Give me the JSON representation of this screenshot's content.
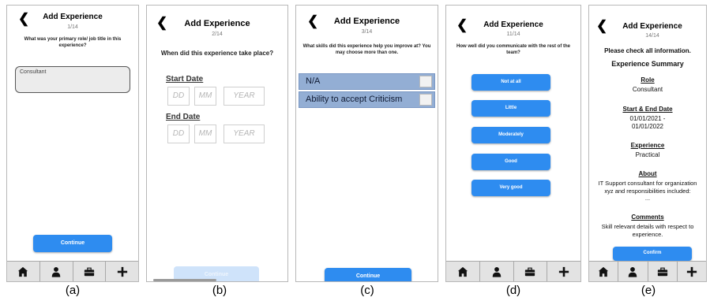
{
  "panel_a": {
    "back": "❮",
    "title": "Add Experience",
    "step": "1/14",
    "question": "What was your primary role/ job title in this experience?",
    "input_value": "Consultant",
    "continue_label": "Continue",
    "caption": "(a)"
  },
  "panel_b": {
    "back": "❮",
    "title": "Add Experience",
    "step": "2/14",
    "question": "When did this experience take place?",
    "start_label": "Start Date",
    "end_label": "End Date",
    "dd_placeholder": "DD",
    "mm_placeholder": "MM",
    "year_placeholder": "YEAR",
    "continue_label": "Continue",
    "caption": "(b)"
  },
  "panel_c": {
    "back": "❮",
    "title": "Add Experience",
    "step": "3/14",
    "question": "What skills did this experience help you improve at? You may choose more than one.",
    "skills": [
      "N/A",
      "Ability to accept Criticism"
    ],
    "continue_label": "Continue",
    "caption": "(c)"
  },
  "panel_d": {
    "back": "❮",
    "title": "Add Experience",
    "step": "11/14",
    "question": "How well did you communicate with the rest of the team?",
    "options": [
      "Not at all",
      "Little",
      "Moderately",
      "Good",
      "Very good"
    ],
    "caption": "(d)"
  },
  "panel_e": {
    "back": "❮",
    "title": "Add Experience",
    "step": "14/14",
    "instruction": "Please check all information.",
    "summary_title": "Experience Summary",
    "role_head": "Role",
    "role_value": "Consultant",
    "dates_head": "Start & End Date",
    "dates_value_1": "01/01/2021 -",
    "dates_value_2": "01/01/2022",
    "experience_head": "Experience",
    "experience_value": "Practical",
    "about_head": "About",
    "about_value_1": "IT Support consultant for organization",
    "about_value_2": "xyz and responsibilities included:",
    "about_value_3": "...",
    "comments_head": "Comments",
    "comments_value_1": "Skill relevant details with respect to",
    "comments_value_2": "experience.",
    "confirm_label": "Confirm",
    "caption": "(e)"
  },
  "colors": {
    "accent": "#2e8cf0",
    "skill_row": "#93aed4",
    "tabbar": "#e3e3e3"
  },
  "icons": [
    "home-icon",
    "person-icon",
    "briefcase-icon",
    "plus-icon"
  ]
}
